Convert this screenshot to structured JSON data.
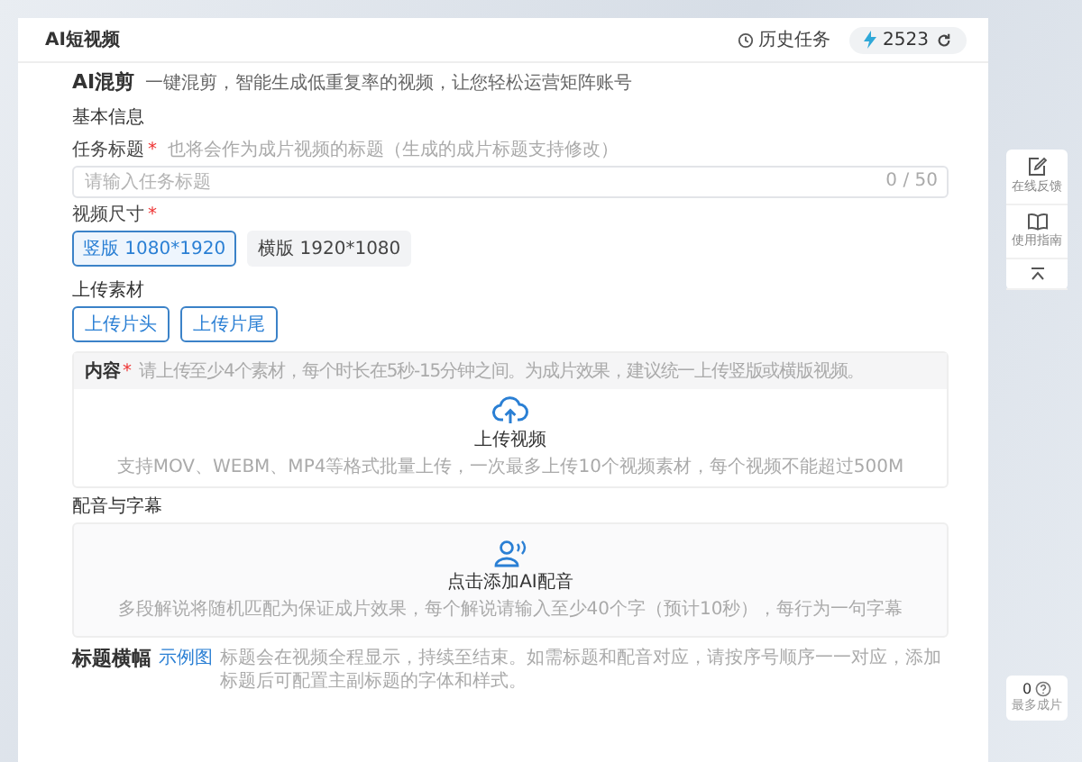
{
  "header": {
    "title": "AI短视频",
    "history": "历史任务",
    "credits": "2523"
  },
  "intro": {
    "title": "AI混剪",
    "subtitle": "一键混剪，智能生成低重复率的视频，让您轻松运营矩阵账号"
  },
  "basic": {
    "heading": "基本信息",
    "task_title": {
      "label": "任务标题",
      "required_mark": "*",
      "hint": "也将会作为成片视频的标题（生成的成片标题支持修改）",
      "placeholder": "请输入任务标题",
      "counter": "0 / 50"
    },
    "size": {
      "label": "视频尺寸",
      "required_mark": "*",
      "options": [
        {
          "label": "竖版 1080*1920",
          "selected": true
        },
        {
          "label": "横版 1920*1080",
          "selected": false
        }
      ]
    }
  },
  "upload": {
    "heading": "上传素材",
    "buttons": [
      "上传片头",
      "上传片尾"
    ],
    "content_label": "内容",
    "required_mark": "*",
    "hint": "请上传至少4个素材，每个时长在5秒-15分钟之间。为成片效果，建议统一上传竖版或横版视频。",
    "drop_title": "上传视频",
    "drop_hint": "支持MOV、WEBM、MP4等格式批量上传，一次最多上传10个视频素材，每个视频不能超过500M"
  },
  "voice": {
    "heading": "配音与字幕",
    "action": "点击添加AI配音",
    "hint": "多段解说将随机匹配为保证成片效果，每个解说请输入至少40个字（预计10秒），每行为一句字幕"
  },
  "banner": {
    "heading": "标题横幅",
    "example_link": "示例图",
    "hint": "标题会在视频全程显示，持续至结束。如需标题和配音对应，请按序号顺序一一对应，添加标题后可配置主副标题的字体和样式。"
  },
  "side_tools": [
    {
      "kind": "feedback",
      "label": "在线反馈"
    },
    {
      "kind": "guide",
      "label": "使用指南"
    },
    {
      "kind": "top"
    }
  ],
  "output_widget": {
    "count": "0",
    "label": "最多成片"
  }
}
